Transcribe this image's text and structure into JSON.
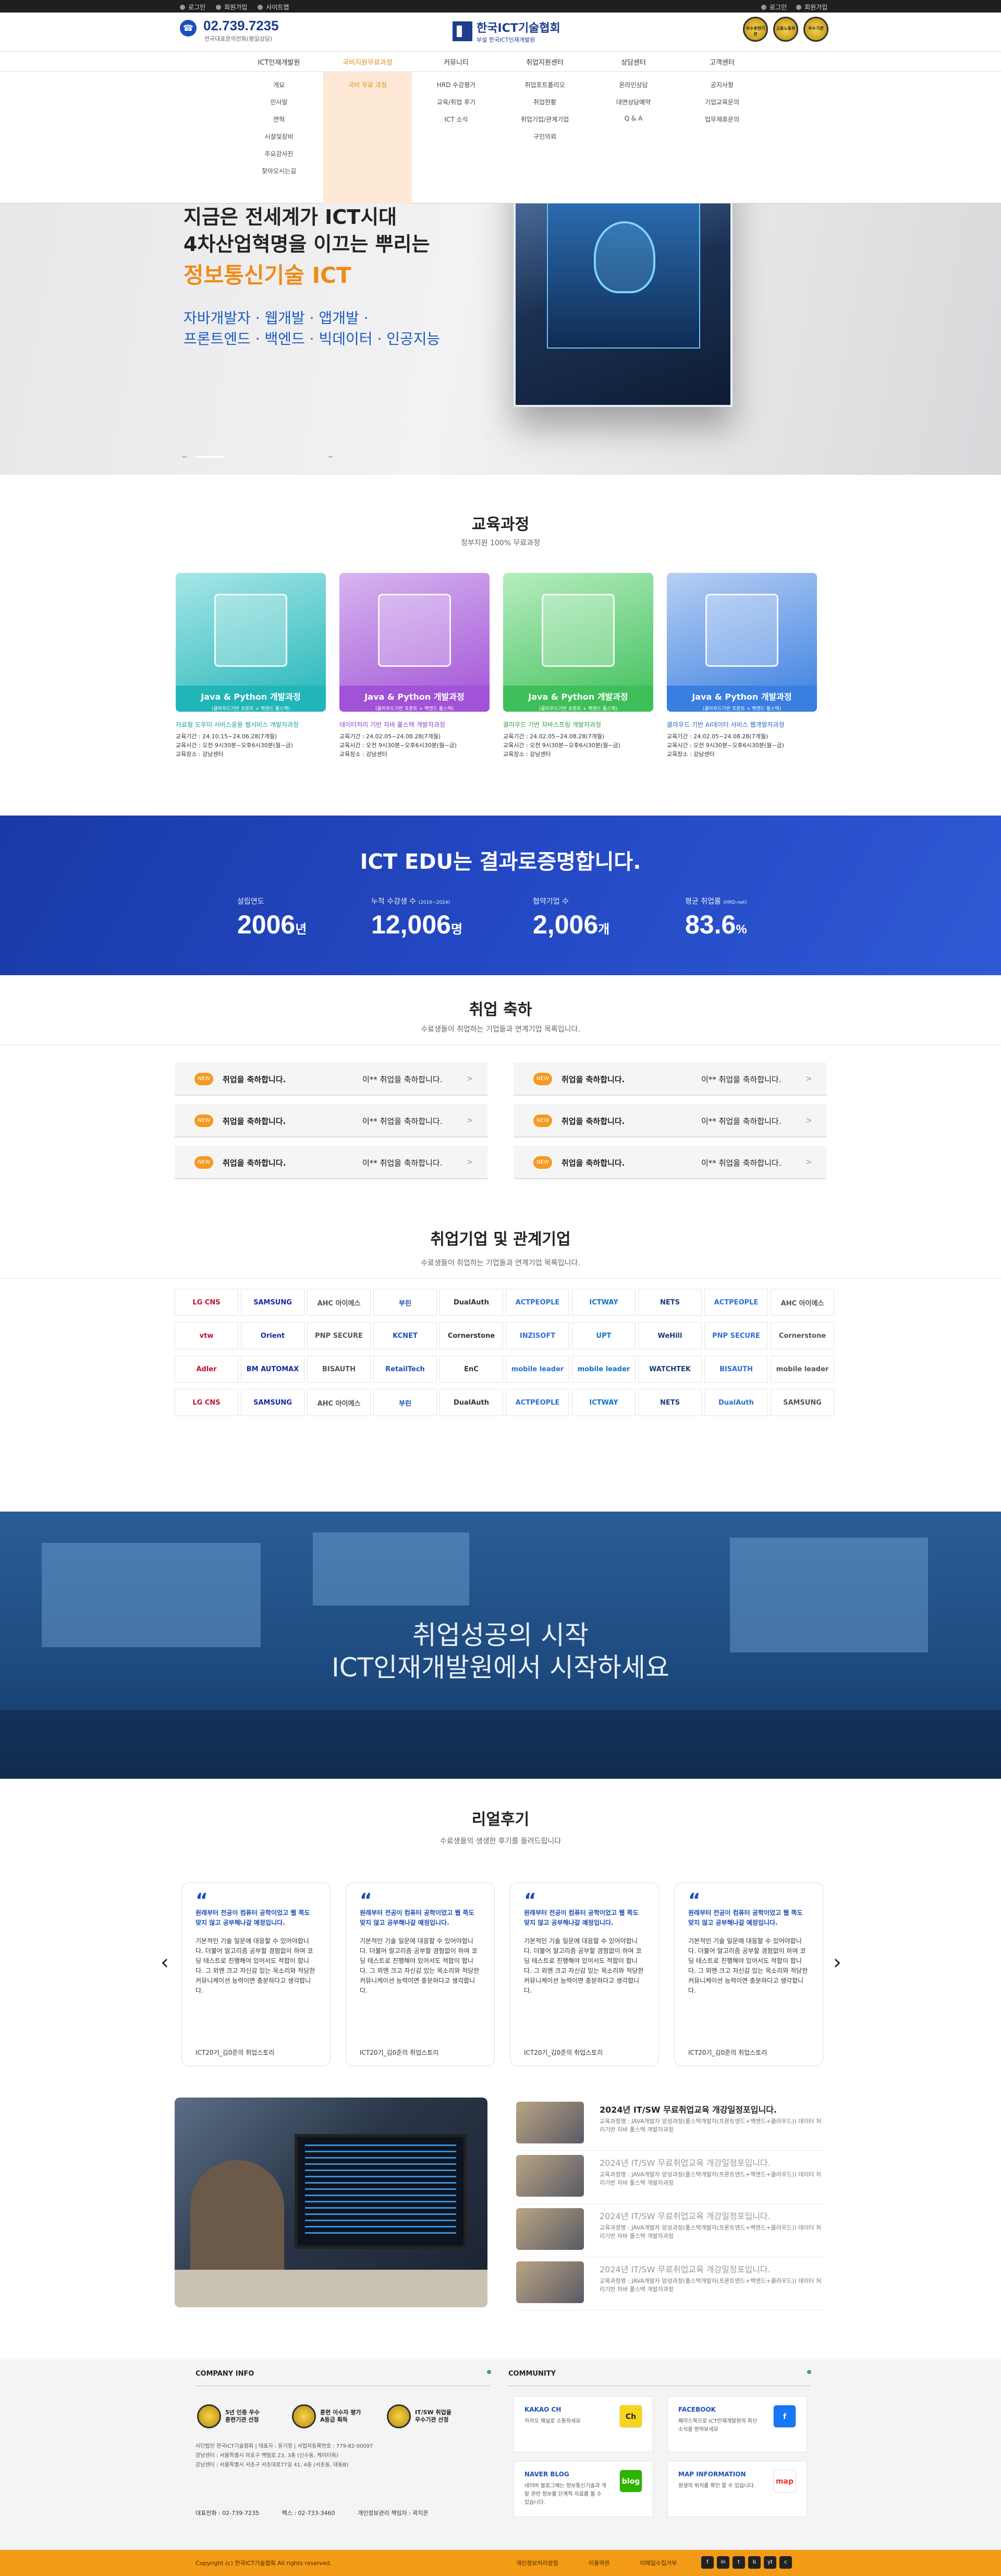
{
  "topbar": {
    "left": [
      "로그인",
      "회원가입",
      "사이트맵"
    ],
    "right": [
      "로그인",
      "회원가입"
    ]
  },
  "header": {
    "phone": "02.739.7235",
    "phone_sub": "전국대표문의전화(평일상담)",
    "logo_title": "한국ICT기술협회",
    "logo_sub": "부설 한국ICT인재개발원",
    "awards": [
      "우수훈련기관",
      "고용노동부",
      "우수기관"
    ]
  },
  "nav": {
    "items": [
      "ICT인재개발원",
      "국비지원무료과정",
      "커뮤니티",
      "취업지원센터",
      "상담센터",
      "고객센터"
    ],
    "submenus": [
      [
        "개요",
        "인사말",
        "연혁",
        "시설및장비",
        "주요강사진",
        "찾아오시는길"
      ],
      [
        "국비 무료 과정"
      ],
      [
        "HRD 수강평가",
        "교육/취업 후기",
        "ICT 소식"
      ],
      [
        "취업포트폴리오",
        "취업현황",
        "취업기업/관계기업",
        "구인의뢰"
      ],
      [
        "온라인상담",
        "대면상담예약",
        "Q & A"
      ],
      [
        "공지사항",
        "기업교육문의",
        "업무제휴문의"
      ]
    ]
  },
  "hero": {
    "line1": "지금은 전세계가 ICT시대",
    "line2": "4차산업혁명을 이끄는 뿌리는",
    "highlight": "정보통신기술 ICT",
    "sub1": "자바개발자 · 웹개발 · 앱개발 ·",
    "sub2": "프론트엔드 · 백엔드 · 빅데이터 · 인공지능"
  },
  "courses": {
    "title": "교육과정",
    "subtitle": "정부지원 100% 무료과정",
    "items": [
      {
        "label": "Java & Python 개발과정",
        "label_sub": "(클라우드기반 프론트 + 백엔드 풀스택)",
        "title": "자료형 도우미 서비스응용 웹서비스 개발자과정",
        "period": "교육기간 : 24.10.15~24.06.28(7개월)",
        "time": "교육시간 : 오전 9시30분~오후6시30분(월~금)",
        "place": "교육장소 : 강남센터",
        "color1": "#a7e6e7",
        "color2": "#22b5b8",
        "title_color": "#1a9ca6"
      },
      {
        "label": "Java & Python 개발과정",
        "label_sub": "(클라우드기반 프론트 + 백엔드 풀스택)",
        "title": "데이터처리 기반 자바 풀스택 개발자과정",
        "period": "교육기간 : 24.02.05~24.08.28(7개월)",
        "time": "교육시간 : 오전 9시30분~오후6시30분(월~금)",
        "place": "교육장소 : 강남센터",
        "color1": "#d7b5ef",
        "color2": "#a152d6",
        "title_color": "#8d3ec7"
      },
      {
        "label": "Java & Python 개발과정",
        "label_sub": "(클라우드기반 프론트 + 백엔드 풀스택)",
        "title": "클라우드 기반 자바스프링 개발자과정",
        "period": "교육기간 : 24.02.05~24.08.28(7개월)",
        "time": "교육시간 : 오전 9시30분~오후6시30분(월~금)",
        "place": "교육장소 : 강남센터",
        "color1": "#b6edbf",
        "color2": "#3fbf5a",
        "title_color": "#2f9e4b"
      },
      {
        "label": "Java & Python 개발과정",
        "label_sub": "(클라우드기반 프론트 + 백엔드 풀스택)",
        "title": "클라우드 기반 AI데이터 서비스 웹개발자과정",
        "period": "교육기간 : 24.02.05~24.08.28(7개월)",
        "time": "교육시간 : 오전 9시30분~오후6시30분(월~금)",
        "place": "교육장소 : 강남센터",
        "color1": "#b7cff3",
        "color2": "#3a7fe0",
        "title_color": "#2766c7"
      }
    ]
  },
  "stats": {
    "title": "ICT EDU는 결과로증명합니다.",
    "items": [
      {
        "label": "설립연도",
        "value": "2006",
        "unit": "년",
        "note": ""
      },
      {
        "label": "누적 수강생 수",
        "value": "12,006",
        "unit": "명",
        "note": "(2016~2024)"
      },
      {
        "label": "협약기업 수",
        "value": "2,006",
        "unit": "개",
        "note": ""
      },
      {
        "label": "평균 취업률",
        "value": "83.6",
        "unit": "%",
        "note": "(HRD-net)"
      }
    ]
  },
  "employment": {
    "title": "취업 축하",
    "subtitle": "수료생들이 취업하는 기업들과 연계기업 목록입니다.",
    "badge": "NEW",
    "items": [
      {
        "text": "취업을 축하합니다.",
        "name": "이** 취업을 축하합니다."
      },
      {
        "text": "취업을 축하합니다.",
        "name": "이** 취업을 축하합니다."
      },
      {
        "text": "취업을 축하합니다.",
        "name": "이** 취업을 축하합니다."
      },
      {
        "text": "취업을 축하합니다.",
        "name": "이** 취업을 축하합니다."
      },
      {
        "text": "취업을 축하합니다.",
        "name": "이** 취업을 축하합니다."
      },
      {
        "text": "취업을 축하합니다.",
        "name": "이** 취업을 축하합니다."
      }
    ],
    "arrow": ">"
  },
  "companies": {
    "title": "취업기업 및 관계기업",
    "subtitle": "수료생들이 취업하는 기업들과 연계기업 목록입니다.",
    "rows": [
      [
        "LG CNS",
        "SAMSUNG",
        "AHC 아이에스",
        "부린",
        "DualAuth",
        "ACTPEOPLE",
        "ICTWAY",
        "NETS",
        "ACTPEOPLE",
        "AHC 아이에스"
      ],
      [
        "vtw",
        "Orient",
        "PNP SECURE",
        "KCNET",
        "Cornerstone",
        "INZISOFT",
        "UPT",
        "WeHill",
        "PNP SECURE",
        "Cornerstone"
      ],
      [
        "Adler",
        "BM AUTOMAX",
        "BISAUTH",
        "RetailTech",
        "EnC",
        "mobile leader",
        "mobile leader",
        "WATCHTEK",
        "BISAUTH",
        "mobile leader"
      ],
      [
        "LG CNS",
        "SAMSUNG",
        "AHC 아이에스",
        "부린",
        "DualAuth",
        "ACTPEOPLE",
        "ICTWAY",
        "NETS",
        "DualAuth",
        "SAMSUNG"
      ]
    ],
    "colors": [
      "#c0122c",
      "#1428a0",
      "#555555",
      "#1d4fb8",
      "#333333",
      "#2b6fd6",
      "#0f72c6",
      "#1a3a7a",
      "#2b6fd6",
      "#555555"
    ]
  },
  "banner": {
    "line1": "취업성공의 시작",
    "line2": "ICT인재개발원에서 시작하세요"
  },
  "reviews": {
    "title": "리얼후기",
    "subtitle": "수료생들의 생생한 후기를 들려드립니다",
    "items": [
      {
        "quote": "원래부터 전공이 컴퓨터 공학이었고 웹 쪽도 맞지 않고 공부해나갈 예정입니다.",
        "body": "기본적인 기술 일문에 대응할 수 있어야합니다. 더불어 알고리즘 공부할 경험없이 하여 코딩 테스트로 진행해야 있어서도 적합이 합니다. 그 외엔 크고 자신감 있는 목소리와 적당한 커뮤니케이션 능력이면 충분하다고 생각합니다.",
        "footer": "ICT20기_김0준의 취업스토리"
      },
      {
        "quote": "원래부터 전공이 컴퓨터 공학이었고 웹 쪽도 맞지 않고 공부해나갈 예정입니다.",
        "body": "기본적인 기술 일문에 대응할 수 있어야합니다. 더불어 알고리즘 공부할 경험없이 하여 코딩 테스트로 진행해야 있어서도 적합이 합니다. 그 외엔 크고 자신감 있는 목소리와 적당한 커뮤니케이션 능력이면 충분하다고 생각합니다.",
        "footer": "ICT20기_김0준의 취업스토리"
      },
      {
        "quote": "원래부터 전공이 컴퓨터 공학이었고 웹 쪽도 맞지 않고 공부해나갈 예정입니다.",
        "body": "기본적인 기술 일문에 대응할 수 있어야합니다. 더불어 알고리즘 공부할 경험없이 하여 코딩 테스트로 진행해야 있어서도 적합이 합니다. 그 외엔 크고 자신감 있는 목소리와 적당한 커뮤니케이션 능력이면 충분하다고 생각합니다.",
        "footer": "ICT20기_김0준의 취업스토리"
      },
      {
        "quote": "원래부터 전공이 컴퓨터 공학이었고 웹 쪽도 맞지 않고 공부해나갈 예정입니다.",
        "body": "기본적인 기술 일문에 대응할 수 있어야합니다. 더불어 알고리즘 공부할 경험없이 하여 코딩 테스트로 진행해야 있어서도 적합이 합니다. 그 외엔 크고 자신감 있는 목소리와 적당한 커뮤니케이션 능력이면 충분하다고 생각합니다.",
        "footer": "ICT20기_김0준의 취업스토리"
      }
    ],
    "prev": "‹",
    "next": "›"
  },
  "news": {
    "items": [
      {
        "title": "2024년 IT/SW 무료취업교육 개강일정포입니다.",
        "desc": "교육과정명 : JAVA개발자 양성과정(풀스택개발자(프론트엔드+백엔드+클라우드)) 데이터 처리기반 자바 풀스택 개발자과정"
      },
      {
        "title": "2024년 IT/SW 무료취업교육 개강일정포입니다.",
        "desc": "교육과정명 : JAVA개발자 양성과정(풀스택개발자(프론트엔드+백엔드+클라우드)) 데이터 처리기반 자바 풀스택 개발자과정"
      },
      {
        "title": "2024년 IT/SW 무료취업교육 개강일정포입니다.",
        "desc": "교육과정명 : JAVA개발자 양성과정(풀스택개발자(프론트엔드+백엔드+클라우드)) 데이터 처리기반 자바 풀스택 개발자과정"
      },
      {
        "title": "2024년 IT/SW 무료취업교육 개강일정포입니다.",
        "desc": "교육과정명 : JAVA개발자 양성과정(풀스택개발자(프론트엔드+백엔드+클라우드)) 데이터 처리기반 자바 풀스택 개발자과정"
      }
    ]
  },
  "footer": {
    "company_title": "COMPANY INFO",
    "community_title": "COMMUNITY",
    "certs": [
      {
        "t1": "5년 인증 우수",
        "t2": "훈련기관 선정"
      },
      {
        "t1": "훈련 이수자 평가",
        "t2": "A등급 획득"
      },
      {
        "t1": "IT/SW 취업을",
        "t2": "우수기관 선정"
      }
    ],
    "info1": "사단법인 한국ICT기술협회 | 대표자 : 윤기정 | 사업자등록번호 : 779-82-00097",
    "info2": "강남센터 : 서울특별시 마포구 백범로 23, 3층 (신수동, 케이터워)",
    "info3": "강남센터 : 서울특별시 서초구 서초대로77길 41, 4층 (서초동, 대동B)",
    "tel": "대표전화 : 02-739-7235",
    "fax": "팩스 : 02-733-3460",
    "privacy": "개인정보관리 책임자 : 곽지은",
    "community": [
      {
        "title": "KAKAO CH",
        "desc": "카카오 채널로 소통하세요",
        "icon": "Ch",
        "color": "#f7d51d"
      },
      {
        "title": "FACEBOOK",
        "desc": "페이스북으로 ICT인재개발원의 최신 소식을 받아보세요",
        "icon": "f",
        "color": "#1877f2"
      },
      {
        "title": "NAVER BLOG",
        "desc": "네이버 블로그에는 정보통신기술과 개발 관련 정보를 단계적 자료를 볼 수 있습니다.",
        "icon": "blog",
        "color": "#2db400"
      },
      {
        "title": "MAP INFORMATION",
        "desc": "원생의 위치를 확인 할 수 있습니다.",
        "icon": "map",
        "color": "#ffffff"
      }
    ]
  },
  "bottom": {
    "copyright": "Copyright (c) 한국ICT기술협회 All rights reserved.",
    "links": [
      "개인정보처리방침",
      "이용약관",
      "이메일수집거부"
    ],
    "social": [
      "f",
      "in",
      "t",
      "b",
      "yt",
      "c"
    ]
  }
}
